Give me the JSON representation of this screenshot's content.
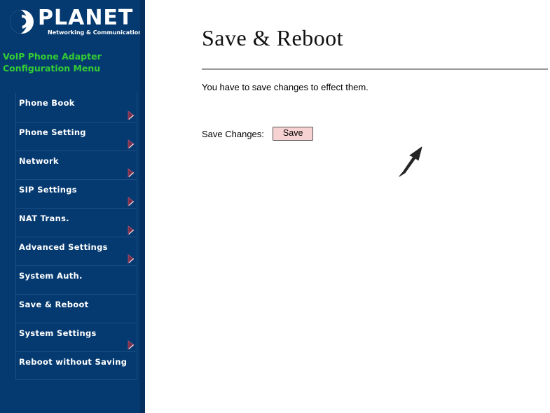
{
  "brand": {
    "name": "PLANET",
    "tagline": "Networking & Communication",
    "logo_icon": "globe-swoosh-icon"
  },
  "sidebar": {
    "title_line1": "VoIP Phone Adapter",
    "title_line2": "Configuration Menu",
    "title_color": "#33cc33",
    "background_color": "#053a70",
    "items": [
      {
        "label": "Phone Book",
        "has_arrow": true,
        "icon": "arrow-right-icon"
      },
      {
        "label": "Phone Setting",
        "has_arrow": true,
        "icon": "arrow-right-icon"
      },
      {
        "label": "Network",
        "has_arrow": true,
        "icon": "arrow-right-icon"
      },
      {
        "label": "SIP Settings",
        "has_arrow": true,
        "icon": "arrow-right-icon"
      },
      {
        "label": "NAT Trans.",
        "has_arrow": true,
        "icon": "arrow-right-icon"
      },
      {
        "label": "Advanced Settings",
        "has_arrow": true,
        "icon": "arrow-right-icon"
      },
      {
        "label": "System Auth.",
        "has_arrow": false,
        "icon": ""
      },
      {
        "label": "Save & Reboot",
        "has_arrow": false,
        "icon": ""
      },
      {
        "label": "System Settings",
        "has_arrow": true,
        "icon": "arrow-right-icon"
      },
      {
        "label": "Reboot without Saving",
        "has_arrow": false,
        "icon": ""
      }
    ]
  },
  "main": {
    "page_title": "Save & Reboot",
    "intro_text": "You have to save changes to effect them.",
    "save_label": "Save Changes:",
    "save_button_label": "Save",
    "save_button_color": "#f7d2d2"
  },
  "annotation": {
    "pointer_icon": "arrow-up-right-pointer-icon"
  }
}
